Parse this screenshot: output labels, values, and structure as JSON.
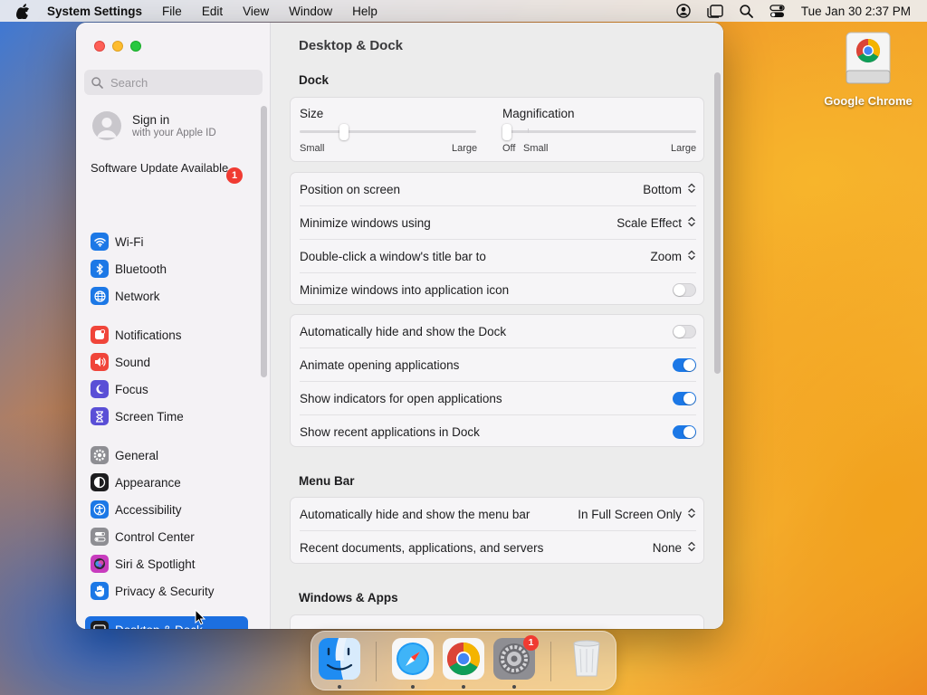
{
  "menubar": {
    "app_name": "System Settings",
    "items": [
      "File",
      "Edit",
      "View",
      "Window",
      "Help"
    ],
    "clock": "Tue Jan 30  2:37 PM",
    "icons": [
      "user-icon",
      "stage-manager-icon",
      "search-icon",
      "control-center-icon"
    ]
  },
  "desktop": {
    "icon_label": "Google Chrome"
  },
  "sidebar": {
    "search_placeholder": "Search",
    "signin_title": "Sign in",
    "signin_subtitle": "with your Apple ID",
    "software_update": "Software Update Available",
    "software_update_badge": "1",
    "items": [
      {
        "label": "Wi-Fi",
        "icon": "wifi-icon",
        "color": "#1c78e6"
      },
      {
        "label": "Bluetooth",
        "icon": "bluetooth-icon",
        "color": "#1c78e6"
      },
      {
        "label": "Network",
        "icon": "globe-icon",
        "color": "#1c78e6"
      },
      {
        "label": "Notifications",
        "icon": "bell-icon",
        "color": "#f0453a"
      },
      {
        "label": "Sound",
        "icon": "speaker-icon",
        "color": "#f0453a"
      },
      {
        "label": "Focus",
        "icon": "moon-icon",
        "color": "#5a4fd6"
      },
      {
        "label": "Screen Time",
        "icon": "hourglass-icon",
        "color": "#5a4fd6"
      },
      {
        "label": "General",
        "icon": "gear-icon",
        "color": "#8e8e93"
      },
      {
        "label": "Appearance",
        "icon": "appearance-icon",
        "color": "#1d1d1f"
      },
      {
        "label": "Accessibility",
        "icon": "accessibility-icon",
        "color": "#1c78e6"
      },
      {
        "label": "Control Center",
        "icon": "control-center-icon",
        "color": "#8e8e93"
      },
      {
        "label": "Siri & Spotlight",
        "icon": "siri-icon",
        "color": "#c83cbe"
      },
      {
        "label": "Privacy & Security",
        "icon": "hand-icon",
        "color": "#1c78e6"
      },
      {
        "label": "Desktop & Dock",
        "icon": "dock-icon",
        "color": "#1d1d1f"
      }
    ]
  },
  "main": {
    "title": "Desktop & Dock",
    "dock_section": "Dock",
    "size_label": "Size",
    "size_min": "Small",
    "size_max": "Large",
    "size_level": 0.25,
    "magnification_label": "Magnification",
    "mag_off": "Off",
    "mag_min": "Small",
    "mag_max": "Large",
    "mag_level": 0,
    "rows_a": [
      {
        "label": "Position on screen",
        "value": "Bottom",
        "type": "select"
      },
      {
        "label": "Minimize windows using",
        "value": "Scale Effect",
        "type": "select"
      },
      {
        "label": "Double-click a window's title bar to",
        "value": "Zoom",
        "type": "select"
      },
      {
        "label": "Minimize windows into application icon",
        "type": "toggle",
        "on": false
      }
    ],
    "rows_b": [
      {
        "label": "Automatically hide and show the Dock",
        "type": "toggle",
        "on": false
      },
      {
        "label": "Animate opening applications",
        "type": "toggle",
        "on": true
      },
      {
        "label": "Show indicators for open applications",
        "type": "toggle",
        "on": true
      },
      {
        "label": "Show recent applications in Dock",
        "type": "toggle",
        "on": true
      }
    ],
    "menubar_section": "Menu Bar",
    "rows_c": [
      {
        "label": "Automatically hide and show the menu bar",
        "value": "In Full Screen Only",
        "type": "select"
      },
      {
        "label": "Recent documents, applications, and servers",
        "value": "None",
        "type": "select"
      }
    ],
    "windows_section": "Windows & Apps"
  },
  "dock": {
    "apps": [
      "Finder",
      "Safari",
      "Google Chrome",
      "System Settings",
      "Trash"
    ],
    "settings_badge": "1"
  },
  "colors": {
    "accent": "#1c78e6",
    "badge": "#f03b32"
  }
}
